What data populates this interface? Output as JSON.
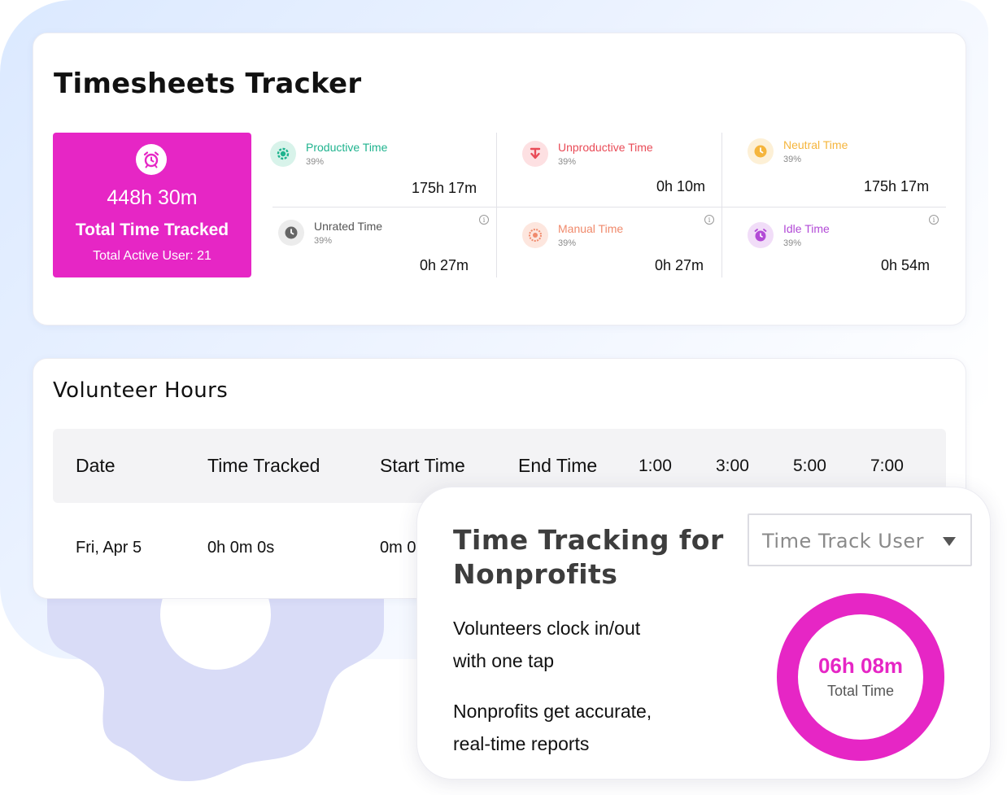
{
  "tracker": {
    "title": "Timesheets Tracker",
    "total": {
      "value": "448h 30m",
      "label": "Total Time Tracked",
      "sub": "Total Active User: 21",
      "color": "#e626c5"
    },
    "metrics": [
      {
        "name": "Productive Time",
        "pct": "39%",
        "value": "175h 17m",
        "color": "#1fb38e",
        "icon": "gear-clock-icon"
      },
      {
        "name": "Unproductive Time",
        "pct": "39%",
        "value": "0h 10m",
        "color": "#e94b57",
        "icon": "arrow-down-icon"
      },
      {
        "name": "Neutral Time",
        "pct": "39%",
        "value": "175h 17m",
        "color": "#f5b53c",
        "icon": "clock-icon"
      },
      {
        "name": "Unrated Time",
        "pct": "39%",
        "value": "0h 27m",
        "color": "#666666",
        "icon": "clock-icon"
      },
      {
        "name": "Manual Time",
        "pct": "39%",
        "value": "0h 27m",
        "color": "#f08a6c",
        "icon": "hand-icon"
      },
      {
        "name": "Idle Time",
        "pct": "39%",
        "value": "0h 54m",
        "color": "#b24ad6",
        "icon": "alarm-icon"
      }
    ]
  },
  "volunteer": {
    "title": "Volunteer Hours",
    "columns": [
      "Date",
      "Time Tracked",
      "Start Time",
      "End Time",
      "1:00",
      "3:00",
      "5:00",
      "7:00"
    ],
    "row": [
      "Fri, Apr 5",
      "0h 0m 0s",
      "0m 0"
    ]
  },
  "promo": {
    "title": "Time Tracking for Nonprofits",
    "lines": [
      "Volunteers clock in/out",
      "with one tap",
      "Nonprofits get accurate,",
      "real-time reports"
    ],
    "dropdown": "Time Track User",
    "ring_value": "06h 08m",
    "ring_label": "Total Time"
  }
}
